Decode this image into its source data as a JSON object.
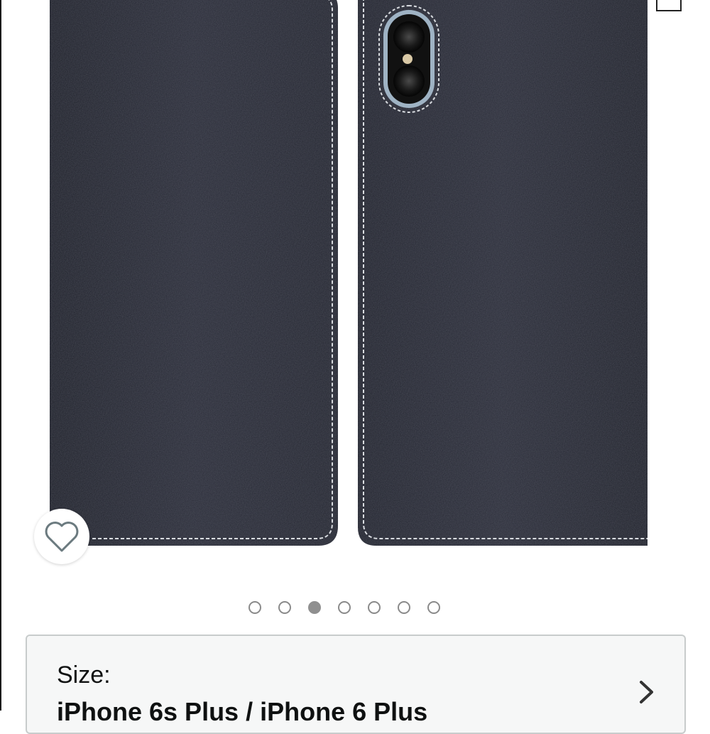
{
  "gallery": {
    "image_alt": "Black leather flip case for iPhone, front and back view",
    "total_images": 7,
    "active_index": 2
  },
  "size_selector": {
    "label": "Size:",
    "value": "iPhone 6s Plus / iPhone 6 Plus"
  },
  "icons": {
    "wishlist": "heart-icon",
    "next": "chevron-right-icon",
    "expand": "expand-icon"
  },
  "colors": {
    "leather": "#262833",
    "stitch": "#d9dce0",
    "dot_active": "#8f8f8f",
    "card_border": "#c8cccc"
  }
}
